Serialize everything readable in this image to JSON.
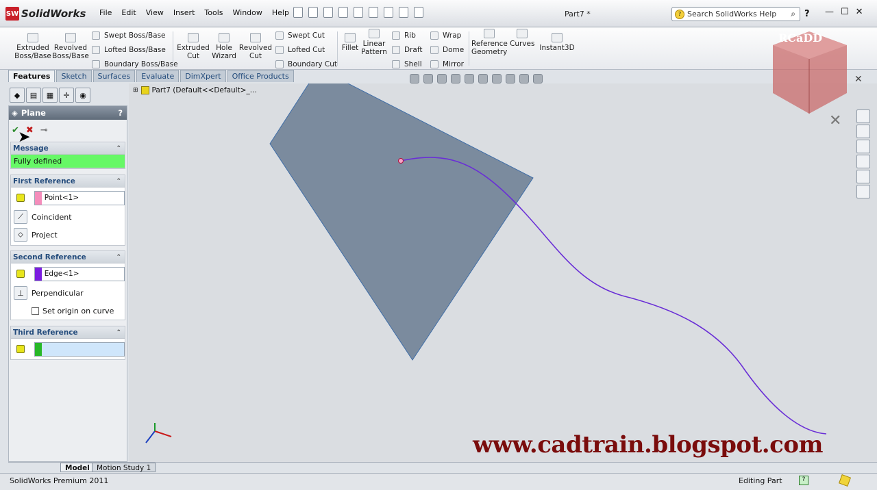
{
  "app": {
    "name": "SolidWorks",
    "logo_text": "SW",
    "doc_title": "Part7 *",
    "version": "SolidWorks Premium 2011",
    "status_mode": "Editing Part"
  },
  "menu": [
    "File",
    "Edit",
    "View",
    "Insert",
    "Tools",
    "Window",
    "Help"
  ],
  "search": {
    "placeholder": "Search SolidWorks Help"
  },
  "ribbon": {
    "big": [
      {
        "label": "Extruded\nBoss/Base"
      },
      {
        "label": "Revolved\nBoss/Base"
      },
      {
        "label": "Extruded\nCut"
      },
      {
        "label": "Hole\nWizard"
      },
      {
        "label": "Revolved\nCut"
      },
      {
        "label": "Fillet"
      },
      {
        "label": "Linear\nPattern"
      },
      {
        "label": "Reference\nGeometry"
      },
      {
        "label": "Curves"
      },
      {
        "label": "Instant3D"
      }
    ],
    "small": [
      {
        "label": "Swept Boss/Base"
      },
      {
        "label": "Lofted Boss/Base"
      },
      {
        "label": "Boundary Boss/Base"
      },
      {
        "label": "Swept Cut"
      },
      {
        "label": "Lofted Cut"
      },
      {
        "label": "Boundary Cut"
      },
      {
        "label": "Rib"
      },
      {
        "label": "Draft"
      },
      {
        "label": "Shell"
      },
      {
        "label": "Wrap"
      },
      {
        "label": "Dome"
      },
      {
        "label": "Mirror"
      }
    ]
  },
  "command_tabs": [
    "Features",
    "Sketch",
    "Surfaces",
    "Evaluate",
    "DimXpert",
    "Office Products"
  ],
  "tree": {
    "root": "Part7  (Default<<Default>_..."
  },
  "pm": {
    "title": "Plane",
    "help": "?",
    "message_header": "Message",
    "message": "Fully defined",
    "first_ref": {
      "header": "First Reference",
      "selection": "Point<1>",
      "swatch": "#f58dbb",
      "opt1": "Coincident",
      "opt2": "Project"
    },
    "second_ref": {
      "header": "Second Reference",
      "selection": "Edge<1>",
      "swatch": "#7b1de0",
      "opt1": "Perpendicular",
      "checkbox": "Set origin on curve"
    },
    "third_ref": {
      "header": "Third Reference",
      "selection": "",
      "swatch": "#28b828"
    }
  },
  "bottom_tabs": [
    "Model",
    "Motion Study 1"
  ],
  "watermark": "www.cadtrain.blogspot.com",
  "corner_logo": "RCaDD",
  "colors": {
    "plane_fill": "#7b8b9e",
    "curve": "#6a2fd6",
    "fully_defined": "#66f866"
  }
}
